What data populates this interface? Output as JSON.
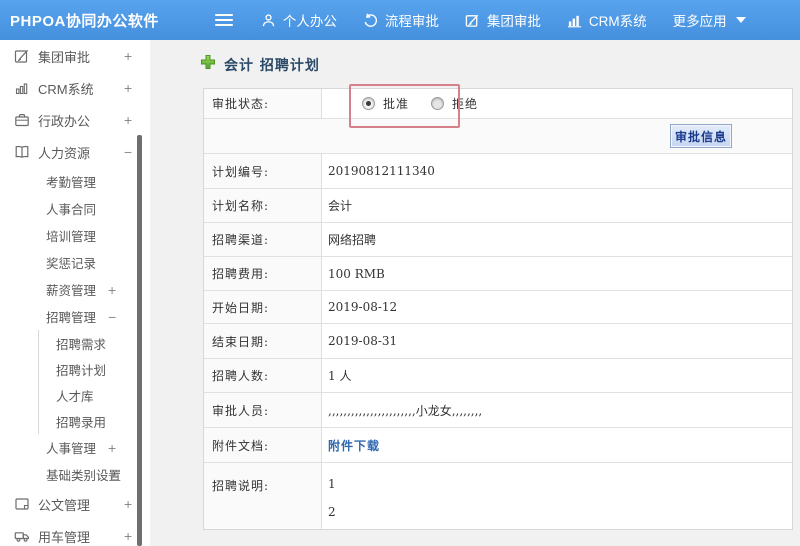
{
  "header": {
    "app_title": "PHPOA协同办公软件",
    "menu": [
      {
        "label": "个人办公",
        "icon": "user-icon"
      },
      {
        "label": "流程审批",
        "icon": "workflow-icon"
      },
      {
        "label": "集团审批",
        "icon": "edit-square-icon"
      },
      {
        "label": "CRM系统",
        "icon": "bar-chart-icon"
      },
      {
        "label": "更多应用",
        "icon": "caret-down-icon"
      }
    ]
  },
  "sidebar": {
    "items": [
      {
        "label": "集团审批",
        "sign": "+",
        "icon": "edit-square-icon",
        "level": 1
      },
      {
        "label": "CRM系统",
        "sign": "+",
        "icon": "bar-chart-icon",
        "level": 1
      },
      {
        "label": "行政办公",
        "sign": "+",
        "icon": "briefcase-icon",
        "level": 1
      },
      {
        "label": "人力资源",
        "sign": "−",
        "icon": "book-icon",
        "level": 1
      },
      {
        "label": "考勤管理",
        "level": 2
      },
      {
        "label": "人事合同",
        "level": 2
      },
      {
        "label": "培训管理",
        "level": 2
      },
      {
        "label": "奖惩记录",
        "level": 2
      },
      {
        "label": "薪资管理",
        "sign": "+",
        "level": 2
      },
      {
        "label": "招聘管理",
        "sign": "−",
        "level": 2
      },
      {
        "label": "招聘需求",
        "level": 3
      },
      {
        "label": "招聘计划",
        "level": 3
      },
      {
        "label": "人才库",
        "level": 3
      },
      {
        "label": "招聘录用",
        "level": 3
      },
      {
        "label": "人事管理",
        "sign": "+",
        "level": 2
      },
      {
        "label": "基础类别设置",
        "sign": "+",
        "level": 2
      },
      {
        "label": "公文管理",
        "sign": "+",
        "icon": "document-icon",
        "level": 1
      },
      {
        "label": "用车管理",
        "sign": "+",
        "icon": "car-icon",
        "level": 1
      }
    ]
  },
  "main": {
    "page_title": "会计 招聘计划",
    "status_row": {
      "label": "审批状态:",
      "options": [
        {
          "label": "批准",
          "selected": true
        },
        {
          "label": "拒绝",
          "selected": false
        }
      ]
    },
    "approve_button": "审批信息",
    "fields": [
      {
        "label": "计划编号:",
        "value": "20190812111340"
      },
      {
        "label": "计划名称:",
        "value": "会计"
      },
      {
        "label": "招聘渠道:",
        "value": "网络招聘"
      },
      {
        "label": "招聘费用:",
        "value": "100 RMB"
      },
      {
        "label": "开始日期:",
        "value": "2019-08-12"
      },
      {
        "label": "结束日期:",
        "value": "2019-08-31"
      },
      {
        "label": "招聘人数:",
        "value": "1 人"
      },
      {
        "label": "审批人员:",
        "value": ",,,,,,,,,,,,,,,,,,,,,,,小龙女,,,,,,,,"
      },
      {
        "label": "附件文档:",
        "value": "附件下载"
      },
      {
        "label": "招聘说明:",
        "line1": "1",
        "line2": "2"
      }
    ]
  },
  "colors": {
    "header_blue": "#4b97e6",
    "annotation_red": "#d5808a",
    "link_blue": "#2f68b0",
    "button_face": "#cfdcf3",
    "button_text": "#1c3a8e",
    "title_navy": "#2a4a68"
  }
}
